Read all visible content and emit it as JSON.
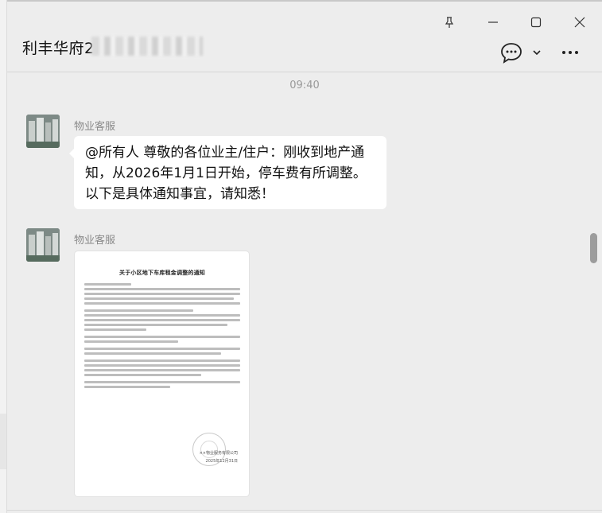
{
  "window": {
    "title": "利丰华府2",
    "controls": {
      "pin_icon": "pin-icon",
      "minimize_icon": "minimize-icon",
      "maximize_icon": "maximize-icon",
      "close_icon": "close-icon"
    }
  },
  "toolbar": {
    "chat_info_icon": "chat-bubble-icon",
    "dropdown_icon": "chevron-down-icon",
    "more_icon": "more-icon"
  },
  "chat": {
    "timestamp": "09:40",
    "messages": [
      {
        "sender": "物业客服",
        "type": "text",
        "lines": [
          "@所有人 尊敬的各位业主/住户：刚收到地产通",
          "知，从2026年1月1日开始，停车费有所调整。",
          "以下是具体通知事宜，请知悉！"
        ]
      },
      {
        "sender": "物业客服",
        "type": "image",
        "image": {
          "doc_title": "关于小区地下车库租金调整的通知",
          "footer_company": "××物业服务有限公司",
          "footer_date": "2025年12月31日"
        }
      }
    ]
  },
  "colors": {
    "background": "#ededed",
    "bubble": "#ffffff",
    "muted_text": "#8a8a8a"
  }
}
